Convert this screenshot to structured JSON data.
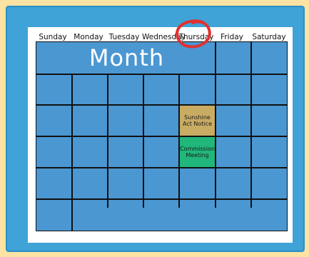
{
  "days": [
    "Sunday",
    "Monday",
    "Tuesday",
    "Wednesday",
    "Thursday",
    "Friday",
    "Saturday"
  ],
  "month_label": "Month",
  "events": {
    "sunshine": "Sunshine Act Notice",
    "commission": "Commission Meeting"
  },
  "colors": {
    "page_bg": "#fde3a3",
    "frame": "#3fa3d8",
    "grid_fill": "#4b97d2",
    "sunshine_cell": "#c9ac63",
    "commission_cell": "#21b77a",
    "highlight_circle": "#e0322e"
  }
}
